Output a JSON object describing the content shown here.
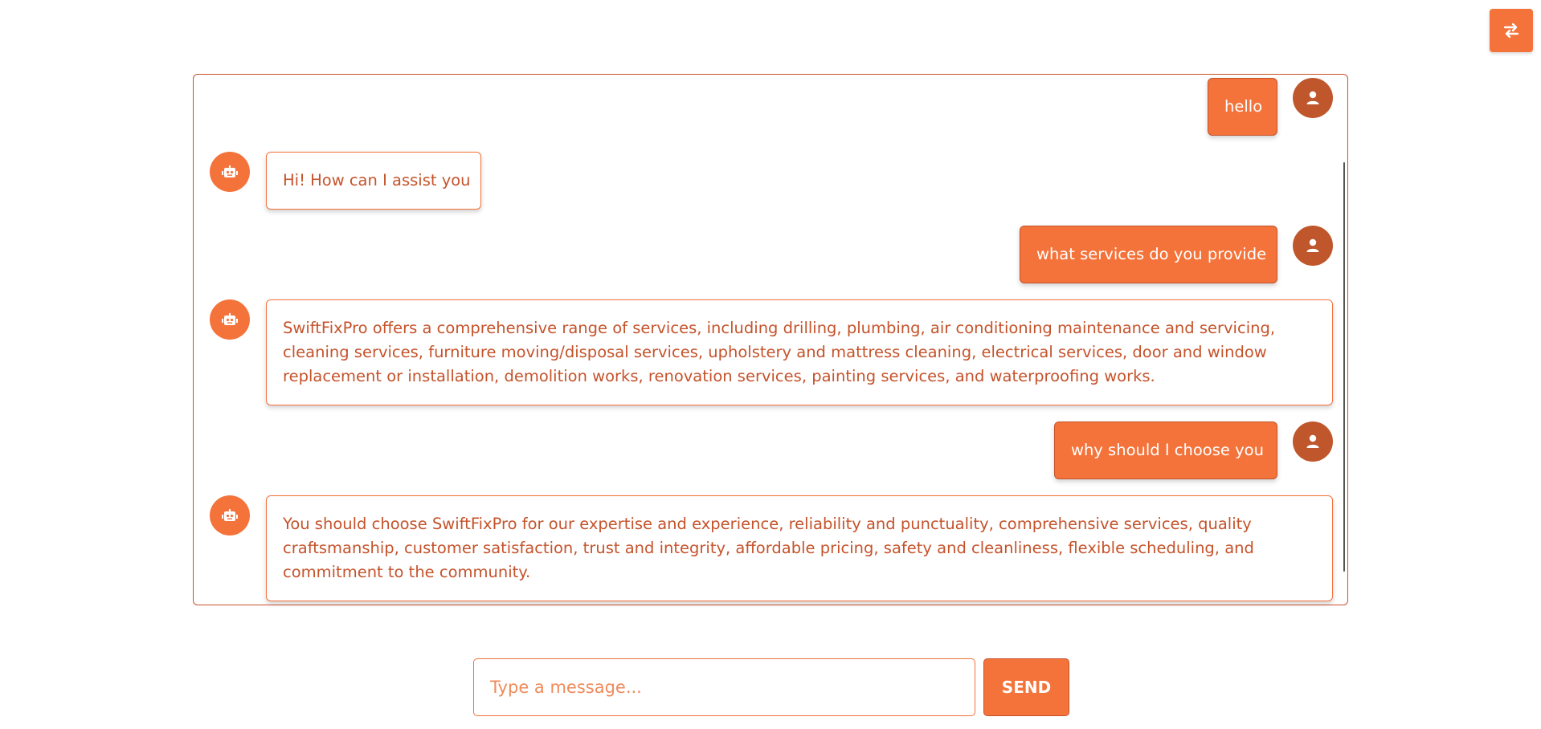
{
  "header": {
    "swap_icon": "swap-arrows-icon"
  },
  "chat": {
    "messages": [
      {
        "sender": "user",
        "text": "hello"
      },
      {
        "sender": "bot",
        "text": "Hi! How can I assist you"
      },
      {
        "sender": "user",
        "text": "what services do you provide"
      },
      {
        "sender": "bot",
        "text": "SwiftFixPro offers a comprehensive range of services, including drilling, plumbing, air conditioning maintenance and servicing, cleaning services, furniture moving/disposal services, upholstery and mattress cleaning, electrical services, door and window replacement or installation, demolition works, renovation services, painting services, and waterproofing works."
      },
      {
        "sender": "user",
        "text": "why should I choose you"
      },
      {
        "sender": "bot",
        "text": "You should choose SwiftFixPro for our expertise and experience, reliability and punctuality, comprehensive services, quality craftsmanship, customer satisfaction, trust and integrity, affordable pricing, safety and cleanliness, flexible scheduling, and commitment to the community."
      }
    ],
    "user_avatar_icon": "person-icon",
    "bot_avatar_icon": "robot-icon"
  },
  "composer": {
    "placeholder": "Type a message...",
    "value": "",
    "send_label": "SEND"
  },
  "colors": {
    "accent": "#f4733a",
    "accent_dark": "#c5532b",
    "user_avatar": "#c0562c"
  }
}
